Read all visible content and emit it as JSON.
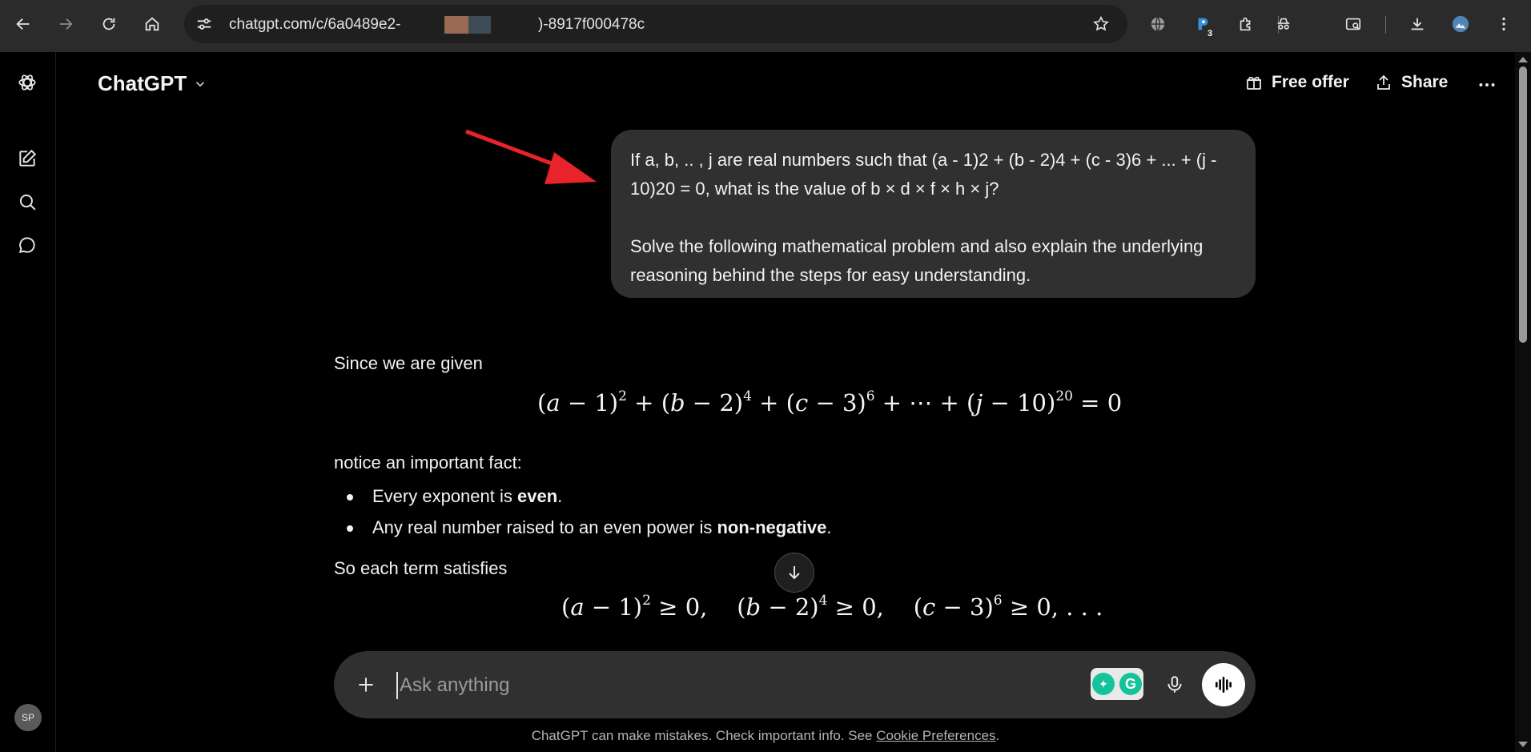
{
  "browser": {
    "url_part1": "chatgpt.com/c/6a0489e2-",
    "url_part2": ")-8917f000478c",
    "extension_badge": "3"
  },
  "header": {
    "model_title": "ChatGPT",
    "free_offer_label": "Free offer",
    "share_label": "Share"
  },
  "user_message": {
    "paragraph1": "If a, b, .. , j are real numbers such that (a - 1)2 + (b - 2)4 + (c - 3)6 + ... + (j - 10)20 = 0, what is the value of b × d × f × h × j?",
    "paragraph2": "Solve the following mathematical problem and also explain the underlying reasoning behind the steps for easy understanding."
  },
  "answer": {
    "intro": "Since we are given",
    "notice": "notice an important fact:",
    "bullet1_text": "Every exponent is ",
    "bullet1_bold": "even",
    "bullet1_end": ".",
    "bullet2_text": "Any real number raised to an even power is ",
    "bullet2_bold": "non-negative",
    "bullet2_end": ".",
    "so_each": "So each term satisfies"
  },
  "composer": {
    "placeholder": "Ask anything"
  },
  "footer": {
    "disclaimer": "ChatGPT can make mistakes. Check important info. See ",
    "link": "Cookie Preferences",
    "end": "."
  },
  "sidebar": {
    "avatar_initials": "SP"
  },
  "colors": {
    "background": "#000000",
    "bubble": "#303030",
    "annotation_arrow": "#e8232a"
  }
}
